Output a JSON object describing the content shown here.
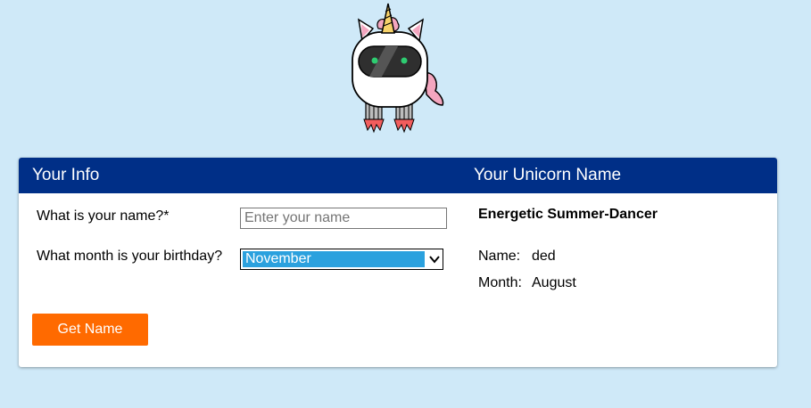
{
  "mascot": {
    "icon": "unicorn-robot-icon"
  },
  "card": {
    "left_title": "Your Info",
    "right_title": "Your Unicorn Name",
    "header_color": "#002f87"
  },
  "form": {
    "name_label": "What is your name?*",
    "name_placeholder": "Enter your name",
    "name_value": "",
    "month_label": "What month is your birthday?",
    "month_selected": "November",
    "button_label": "Get Name",
    "button_color": "#ff6a00"
  },
  "result": {
    "unicorn_name": "Energetic Summer-Dancer",
    "name_label": "Name:",
    "name_value": "ded",
    "month_label": "Month:",
    "month_value": "August"
  },
  "colors": {
    "background": "#cfe9f8",
    "select_highlight": "#2ba1de"
  }
}
